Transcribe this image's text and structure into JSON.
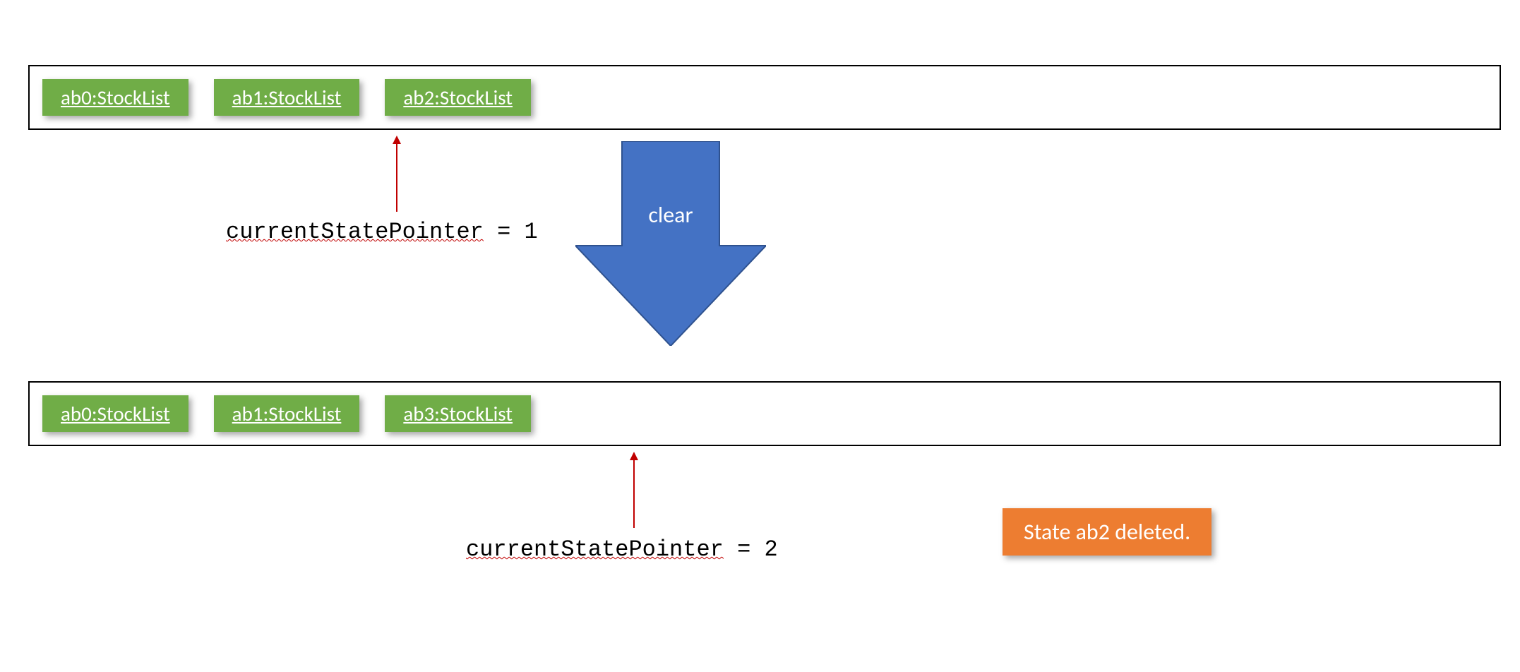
{
  "top": {
    "items": [
      {
        "label": "ab0:StockList"
      },
      {
        "label": "ab1:StockList"
      },
      {
        "label": "ab2:StockList"
      }
    ],
    "pointer": {
      "label_key": "currentStatePointer",
      "value": "= 1"
    }
  },
  "bottom": {
    "items": [
      {
        "label": "ab0:StockList"
      },
      {
        "label": "ab1:StockList"
      },
      {
        "label": "ab3:StockList"
      }
    ],
    "pointer": {
      "label_key": "currentStatePointer",
      "value": "= 2"
    }
  },
  "transition": {
    "label": "clear"
  },
  "badge": {
    "text": "State ab2 deleted."
  },
  "colors": {
    "green": "#70AD47",
    "blue": "#4472C4",
    "orange": "#ED7D31",
    "red_arrow": "#C00000"
  }
}
